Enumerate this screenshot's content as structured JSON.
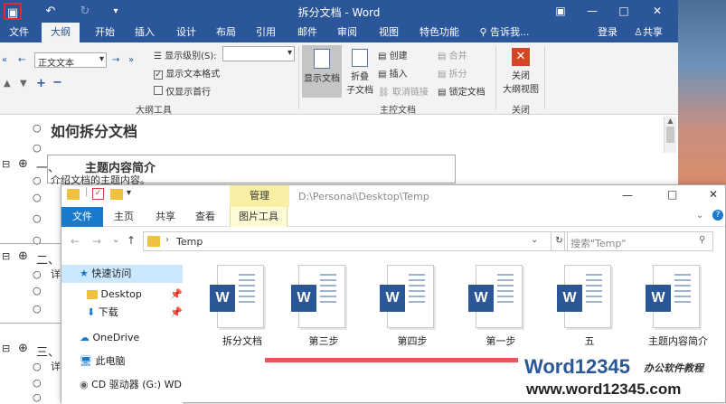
{
  "word": {
    "title": "拆分文档 - Word",
    "tabs": [
      "文件",
      "大纲",
      "开始",
      "插入",
      "设计",
      "布局",
      "引用",
      "邮件",
      "审阅",
      "视图",
      "特色功能"
    ],
    "tell_me": "告诉我...",
    "login": "登录",
    "share": "共享",
    "ribbon": {
      "level": "正文文本",
      "show_level": "显示级别(S):",
      "show_format": "显示文本格式",
      "first_line": "仅显示首行",
      "show_doc": "显示文档",
      "collapse": "折叠",
      "subdoc": "子文档",
      "create": "创建",
      "insert": "插入",
      "unlink": "取消链接",
      "merge": "合并",
      "split": "拆分",
      "lock": "锁定文档",
      "close": "关闭",
      "close_outline": "大纲视图",
      "grp_outline": "大纲工具",
      "grp_master": "主控文档",
      "grp_close": "关闭"
    },
    "doc": {
      "title": "如何拆分文档",
      "h1_num": "一、",
      "h1": "主题内容简介",
      "p1": "介绍文档的主题内容。",
      "h2": "二、",
      "p2": "详",
      "h3": "三、",
      "p3": "详"
    }
  },
  "explorer": {
    "manage": "管理",
    "path_title": "D:\\Personal\\Desktop\\Temp",
    "tabs": [
      "文件",
      "主页",
      "共享",
      "查看",
      "图片工具"
    ],
    "breadcrumb": "Temp",
    "search_placeholder": "搜索\"Temp\"",
    "sidebar": [
      "快速访问",
      "Desktop",
      "下载",
      "OneDrive",
      "此电脑",
      "CD 驱动器 (G:) WD"
    ],
    "files": [
      "拆分文档",
      "第三步",
      "第四步",
      "第一步",
      "五",
      "主题内容简介"
    ]
  },
  "watermark": {
    "brand": "Word12345",
    "sub": "办公软件教程",
    "url": "www.word12345.com"
  }
}
